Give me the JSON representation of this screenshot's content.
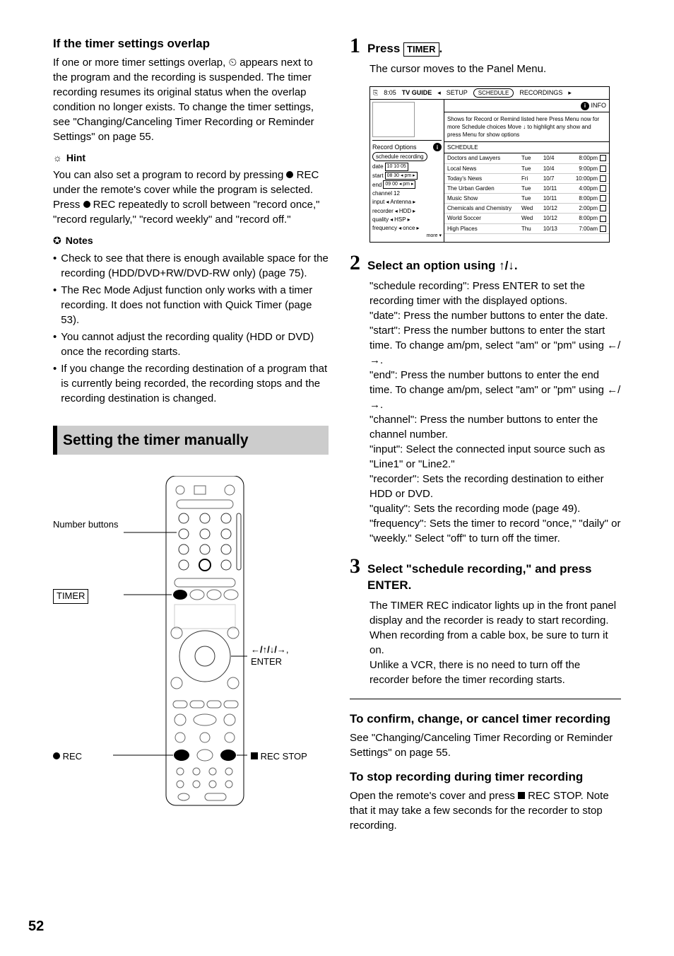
{
  "left": {
    "heading1": "If the timer settings overlap",
    "para1": "If one or more timer settings overlap, ⏲ appears next to the program and the recording is suspended. The timer recording resumes its original status when the overlap condition no longer exists. To change the timer settings, see \"Changing/Canceling Timer Recording or Reminder Settings\" on page 55.",
    "hint_label": "Hint",
    "hint_text_a": "You can also set a program to record by pressing ",
    "hint_rec": " REC",
    "hint_text_b": " under the remote's cover while the program is selected. Press ",
    "hint_text_c": " REC repeatedly to scroll between \"record once,\" \"record regularly,\" \"record weekly\" and \"record off.\"",
    "notes_label": "Notes",
    "notes": [
      "Check to see that there is enough available space for the recording (HDD/DVD+RW/DVD-RW only) (page 75).",
      "The Rec Mode Adjust function only works with a timer recording. It does not function with Quick Timer (page 53).",
      "You cannot adjust the recording quality (HDD or DVD) once the recording starts.",
      "If you change the recording destination of a program that is currently being recorded, the recording stops and the recording destination is changed."
    ],
    "section_heading": "Setting the timer manually",
    "callouts": {
      "number_buttons": "Number buttons",
      "timer": "TIMER",
      "rec": "REC",
      "arrows_enter": "←/↑/↓/→, ENTER",
      "rec_stop": "REC STOP"
    }
  },
  "right": {
    "step1_title_a": "Press ",
    "step1_timer": "TIMER",
    "step1_title_b": ".",
    "step1_body": "The cursor moves to the Panel Menu.",
    "tv": {
      "time": "8:05",
      "guide": "TV GUIDE",
      "setup": "SETUP",
      "schedule_tab": "SCHEDULE",
      "recordings_tab": "RECORDINGS",
      "info": "INFO",
      "msg": "Shows for Record or Remind listed here Press Menu now for more Schedule choices Move ↓ to highlight any show and press Menu for show options",
      "record_options": "Record Options",
      "schedule_recording": "schedule recording",
      "fields": {
        "date": "date",
        "date_v": "10  10  05",
        "start": "start",
        "start_v": "08  30  ◂ pm ▸",
        "end": "end",
        "end_v": "09  00  ◂ pm ▸",
        "channel": "channel",
        "channel_v": "12",
        "input": "input",
        "input_v": "Antenna",
        "recorder": "recorder",
        "recorder_v": "HDD",
        "quality": "quality",
        "quality_v": "HSP",
        "frequency": "frequency",
        "frequency_v": "once",
        "more": "more ▾"
      },
      "schedule_header": "SCHEDULE",
      "rows": [
        {
          "title": "Doctors and Lawyers",
          "day": "Tue",
          "date": "10/4",
          "time": "8:00pm"
        },
        {
          "title": "Local News",
          "day": "Tue",
          "date": "10/4",
          "time": "9:00pm"
        },
        {
          "title": "Today's News",
          "day": "Fri",
          "date": "10/7",
          "time": "10:00pm"
        },
        {
          "title": "The Urban Garden",
          "day": "Tue",
          "date": "10/11",
          "time": "4:00pm"
        },
        {
          "title": "Music Show",
          "day": "Tue",
          "date": "10/11",
          "time": "8:00pm"
        },
        {
          "title": "Chemicals and Chemistry",
          "day": "Wed",
          "date": "10/12",
          "time": "2:00pm"
        },
        {
          "title": "World Soccer",
          "day": "Wed",
          "date": "10/12",
          "time": "8:00pm"
        },
        {
          "title": "High Places",
          "day": "Thu",
          "date": "10/13",
          "time": "7:00am"
        }
      ]
    },
    "step2_title": "Select an option using ↑/↓.",
    "step2_body": "\"schedule recording\": Press ENTER to set the recording timer with the displayed options.\n\"date\": Press the number buttons to enter the date.\n\"start\": Press the number buttons to enter the start time. To change am/pm, select \"am\" or \"pm\" using ←/→.\n\"end\": Press the number buttons to enter the end time. To change am/pm, select \"am\" or \"pm\" using ←/→.\n\"channel\": Press the number buttons to enter the channel number.\n\"input\": Select the connected input source such as \"Line1\" or \"Line2.\"\n\"recorder\": Sets the recording destination to either HDD or DVD.\n\"quality\": Sets the recording mode (page 49).\n\"frequency\": Sets the timer to record \"once,\" \"daily\" or \"weekly.\" Select \"off\" to turn off the timer.",
    "step3_title": "Select \"schedule recording,\" and press ENTER.",
    "step3_body": "The TIMER REC indicator lights up in the front panel display and the recorder is ready to start recording. When recording from a cable box, be sure to turn it on.\nUnlike a VCR, there is no need to turn off the recorder before the timer recording starts.",
    "sub1_title": "To confirm, change, or cancel timer recording",
    "sub1_body": "See \"Changing/Canceling Timer Recording or Reminder Settings\" on page 55.",
    "sub2_title": "To stop recording during timer recording",
    "sub2_body_a": "Open the remote's cover and press ",
    "sub2_body_b": " REC STOP. Note that it may take a few seconds for the recorder to stop recording."
  },
  "page": "52"
}
